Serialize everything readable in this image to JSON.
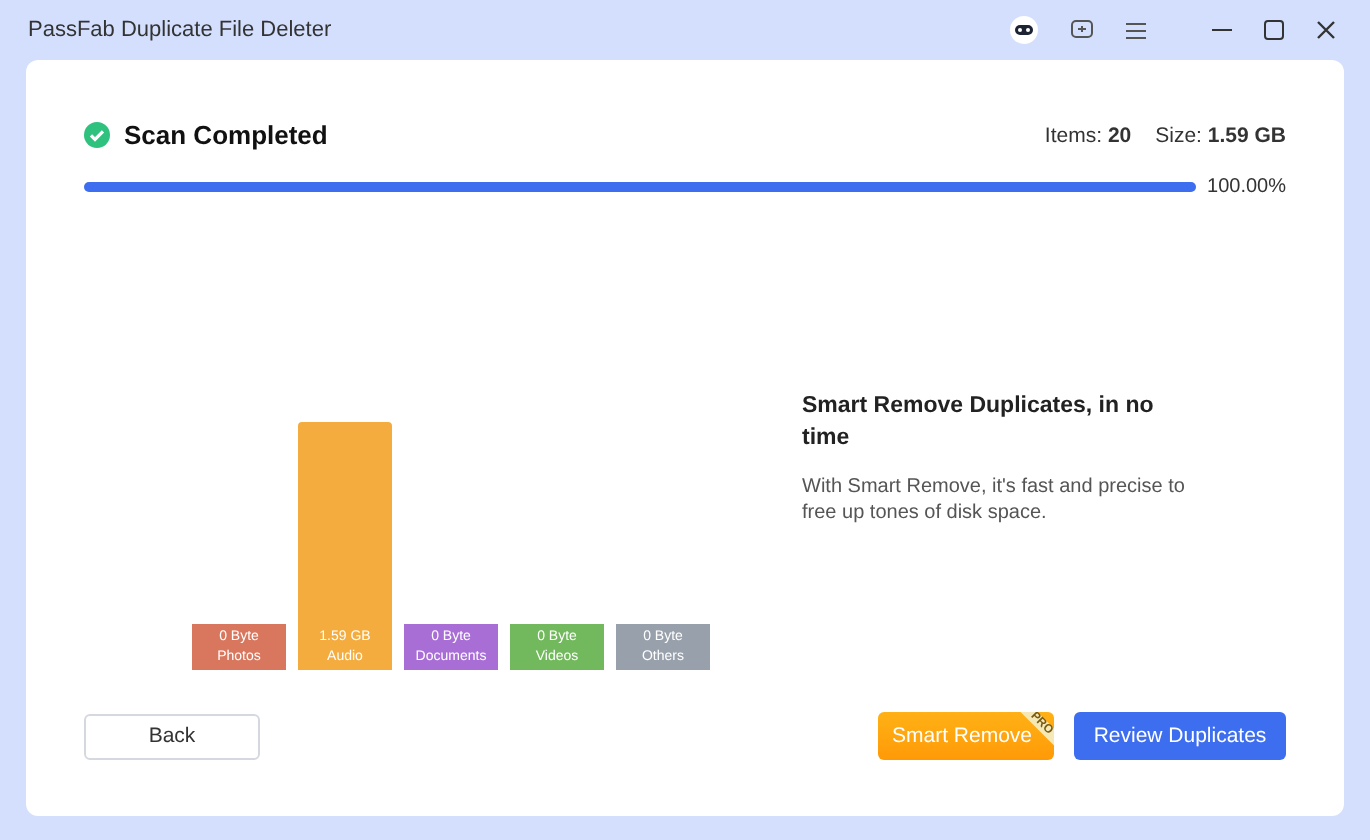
{
  "window": {
    "title": "PassFab Duplicate File Deleter"
  },
  "scan": {
    "status": "Scan Completed",
    "items_label": "Items:",
    "items": "20",
    "size_label": "Size:",
    "size": "1.59 GB",
    "level": 1,
    "percent": "100.00%"
  },
  "categories": [
    {
      "value": "0 Byte",
      "name": "Photos",
      "color": "#d9775e",
      "filled": false
    },
    {
      "value": "1.59 GB",
      "name": "Audio",
      "color": "#f5ac3e",
      "filled": true
    },
    {
      "value": "0 Byte",
      "name": "Documents",
      "color": "#a86ed6",
      "filled": false
    },
    {
      "value": "0 Byte",
      "name": "Videos",
      "color": "#72b85c",
      "filled": false
    },
    {
      "value": "0 Byte",
      "name": "Others",
      "color": "#98a0ab",
      "filled": false
    }
  ],
  "promo": {
    "title": "Smart Remove Duplicates, in no time",
    "text": "With Smart Remove, it's fast and precise to free up tones of disk space."
  },
  "buttons": {
    "back": "Back",
    "smart": "Smart Remove",
    "badge": "PRO",
    "review": "Review Duplicates"
  }
}
